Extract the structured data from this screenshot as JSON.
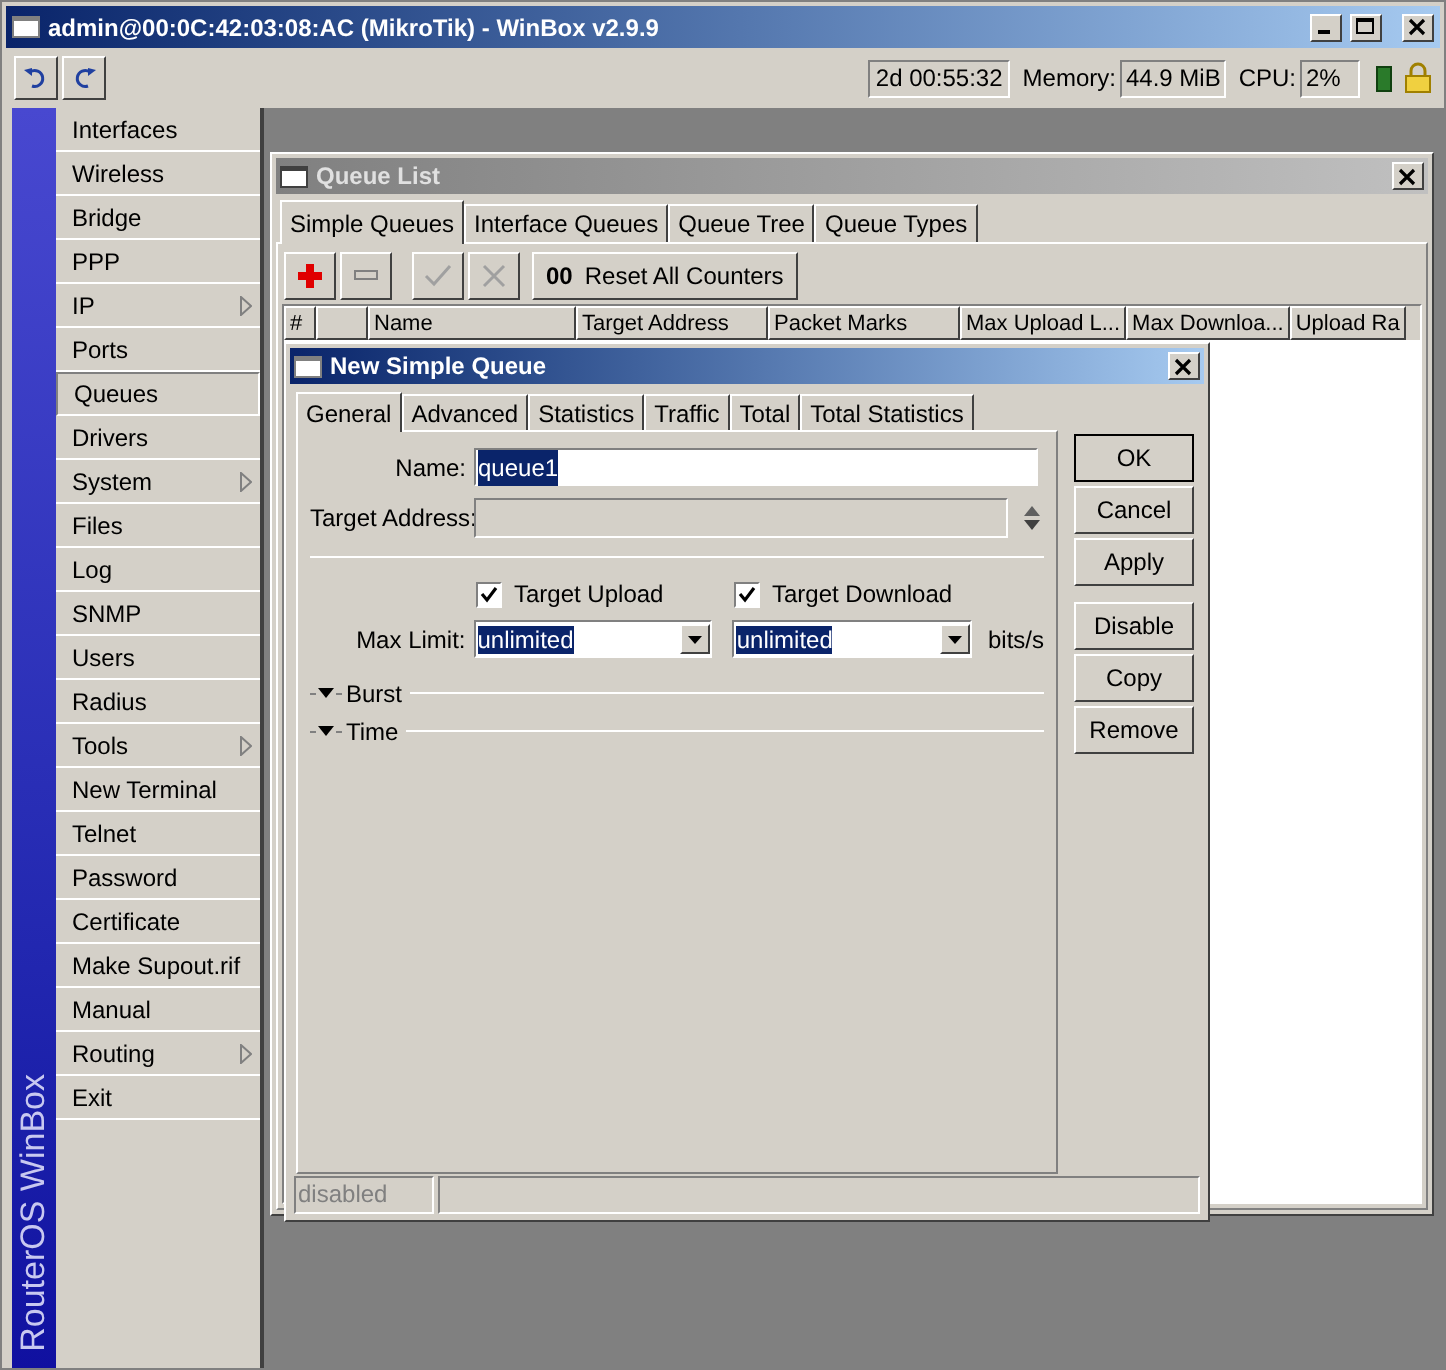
{
  "window": {
    "title": "admin@00:0C:42:03:08:AC (MikroTik) - WinBox v2.9.9"
  },
  "toolbar": {
    "uptime": "2d 00:55:32",
    "memory_label": "Memory:",
    "memory": "44.9 MiB",
    "cpu_label": "CPU:",
    "cpu": "2%"
  },
  "sidebar": {
    "brand": "RouterOS WinBox",
    "items": [
      {
        "label": "Interfaces",
        "selected": false,
        "submenu": false
      },
      {
        "label": "Wireless",
        "selected": false,
        "submenu": false
      },
      {
        "label": "Bridge",
        "selected": false,
        "submenu": false
      },
      {
        "label": "PPP",
        "selected": false,
        "submenu": false
      },
      {
        "label": "IP",
        "selected": false,
        "submenu": true
      },
      {
        "label": "Ports",
        "selected": false,
        "submenu": false
      },
      {
        "label": "Queues",
        "selected": true,
        "submenu": false
      },
      {
        "label": "Drivers",
        "selected": false,
        "submenu": false
      },
      {
        "label": "System",
        "selected": false,
        "submenu": true
      },
      {
        "label": "Files",
        "selected": false,
        "submenu": false
      },
      {
        "label": "Log",
        "selected": false,
        "submenu": false
      },
      {
        "label": "SNMP",
        "selected": false,
        "submenu": false
      },
      {
        "label": "Users",
        "selected": false,
        "submenu": false
      },
      {
        "label": "Radius",
        "selected": false,
        "submenu": false
      },
      {
        "label": "Tools",
        "selected": false,
        "submenu": true
      },
      {
        "label": "New Terminal",
        "selected": false,
        "submenu": false
      },
      {
        "label": "Telnet",
        "selected": false,
        "submenu": false
      },
      {
        "label": "Password",
        "selected": false,
        "submenu": false
      },
      {
        "label": "Certificate",
        "selected": false,
        "submenu": false
      },
      {
        "label": "Make Supout.rif",
        "selected": false,
        "submenu": false
      },
      {
        "label": "Manual",
        "selected": false,
        "submenu": false
      },
      {
        "label": "Routing",
        "selected": false,
        "submenu": true
      },
      {
        "label": "Exit",
        "selected": false,
        "submenu": false
      }
    ]
  },
  "queue_list": {
    "title": "Queue List",
    "tabs": [
      {
        "label": "Simple Queues",
        "selected": true
      },
      {
        "label": "Interface Queues",
        "selected": false
      },
      {
        "label": "Queue Tree",
        "selected": false
      },
      {
        "label": "Queue Types",
        "selected": false
      }
    ],
    "actions": [
      {
        "kind": "add",
        "disabled": false
      },
      {
        "kind": "remove",
        "disabled": false
      },
      {
        "kind": "enable",
        "disabled": true
      },
      {
        "kind": "disable",
        "disabled": true
      }
    ],
    "reset_icon": "00",
    "reset_button": "Reset All Counters",
    "columns": [
      "#",
      "Name",
      "Target Address",
      "Packet Marks",
      "Max Upload L...",
      "Max Downloa...",
      "Upload Ra"
    ]
  },
  "dialog": {
    "title": "New Simple Queue",
    "tabs": [
      {
        "label": "General",
        "selected": true
      },
      {
        "label": "Advanced",
        "selected": false
      },
      {
        "label": "Statistics",
        "selected": false
      },
      {
        "label": "Traffic",
        "selected": false
      },
      {
        "label": "Total",
        "selected": false
      },
      {
        "label": "Total Statistics",
        "selected": false
      }
    ],
    "name_label": "Name:",
    "name": "queue1",
    "target_address_label": "Target Address:",
    "checks": [
      {
        "label": "Target Upload",
        "checked": true
      },
      {
        "label": "Target Download",
        "checked": true
      }
    ],
    "max_limit_label": "Max Limit:",
    "max_limit": [
      "unlimited",
      "unlimited"
    ],
    "unit": "bits/s",
    "sections": [
      "Burst",
      "Time"
    ],
    "button_groups": [
      [
        "OK",
        "Cancel",
        "Apply"
      ],
      [
        "Disable",
        "Copy",
        "Remove"
      ]
    ],
    "status": "disabled"
  }
}
